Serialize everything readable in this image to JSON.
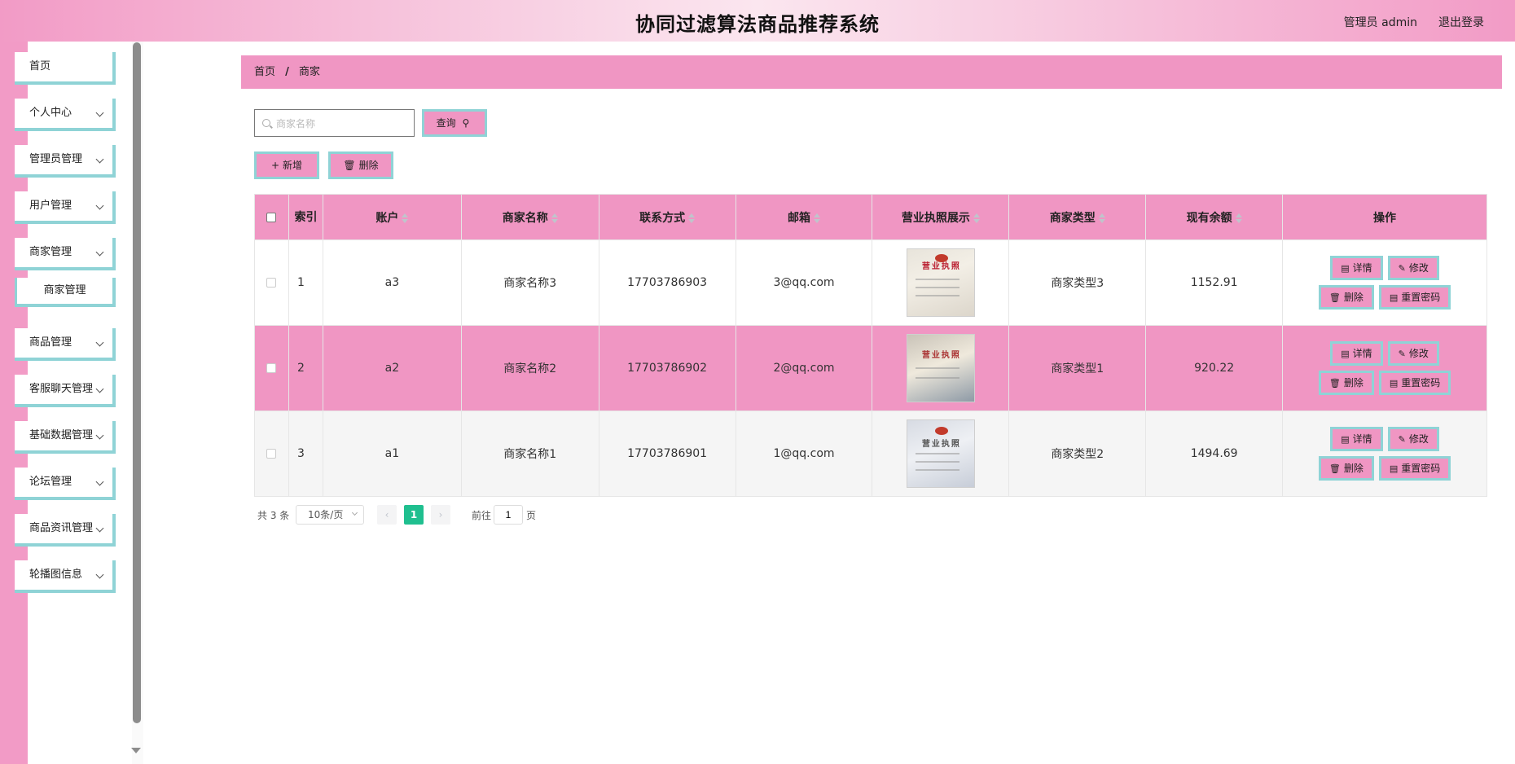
{
  "header": {
    "title": "协同过滤算法商品推荐系统",
    "user": "管理员 admin",
    "logout": "退出登录"
  },
  "sidebar": {
    "items": [
      {
        "label": "首页",
        "expandable": false
      },
      {
        "label": "个人中心",
        "expandable": true
      },
      {
        "label": "管理员管理",
        "expandable": true
      },
      {
        "label": "用户管理",
        "expandable": true
      },
      {
        "label": "商家管理",
        "expandable": true
      },
      {
        "label": "商品管理",
        "expandable": true
      },
      {
        "label": "客服聊天管理",
        "expandable": true
      },
      {
        "label": "基础数据管理",
        "expandable": true
      },
      {
        "label": "论坛管理",
        "expandable": true
      },
      {
        "label": "商品资讯管理",
        "expandable": true
      },
      {
        "label": "轮播图信息",
        "expandable": true
      }
    ],
    "sub_item": "商家管理"
  },
  "breadcrumb": {
    "home": "首页",
    "separator": "/",
    "current": "商家"
  },
  "search": {
    "placeholder": "商家名称",
    "value": "",
    "button": "查询"
  },
  "actions": {
    "add": "新增",
    "delete": "删除"
  },
  "table": {
    "columns": [
      "索引",
      "账户",
      "商家名称",
      "联系方式",
      "邮箱",
      "营业执照展示",
      "商家类型",
      "现有余额",
      "操作"
    ],
    "rows": [
      {
        "index": "1",
        "account": "a3",
        "name": "商家名称3",
        "phone": "17703786903",
        "email": "3@qq.com",
        "type": "商家类型3",
        "balance": "1152.91"
      },
      {
        "index": "2",
        "account": "a2",
        "name": "商家名称2",
        "phone": "17703786902",
        "email": "2@qq.com",
        "type": "商家类型1",
        "balance": "920.22"
      },
      {
        "index": "3",
        "account": "a1",
        "name": "商家名称1",
        "phone": "17703786901",
        "email": "1@qq.com",
        "type": "商家类型2",
        "balance": "1494.69"
      }
    ],
    "row_actions": {
      "detail": "详情",
      "edit": "修改",
      "delete": "删除",
      "reset": "重置密码"
    },
    "license_text": "营业执照"
  },
  "pagination": {
    "total": "共 3 条",
    "page_size": "10条/页",
    "current_page": "1",
    "goto_label": "前往",
    "goto_value": "1",
    "page_suffix": "页"
  },
  "colors": {
    "pink": "#f096c3",
    "teal_border": "#8fd3d6",
    "active_page": "#1fbf8f"
  }
}
